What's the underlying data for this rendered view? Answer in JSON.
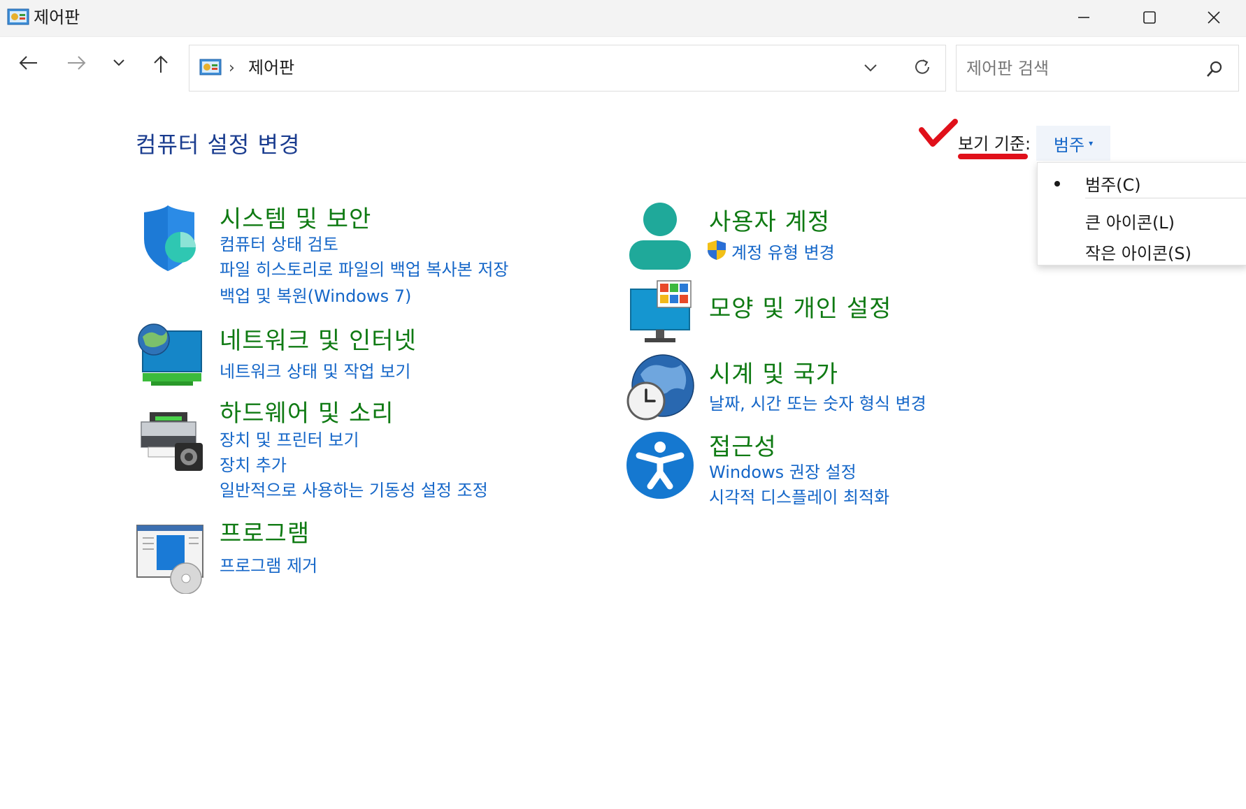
{
  "window": {
    "title": "제어판"
  },
  "address": {
    "breadcrumb": "제어판"
  },
  "search": {
    "placeholder": "제어판 검색"
  },
  "header": {
    "title": "컴퓨터 설정 변경",
    "view_by_label": "보기 기준:",
    "view_by_value": "범주"
  },
  "view_menu": {
    "items": [
      {
        "label": "범주(C)",
        "selected": true
      },
      {
        "label": "큰 아이콘(L)",
        "selected": false
      },
      {
        "label": "작은 아이콘(S)",
        "selected": false
      }
    ]
  },
  "categories": {
    "system_security": {
      "title": "시스템 및 보안",
      "links": [
        "컴퓨터 상태 검토",
        "파일 히스토리로 파일의 백업 복사본 저장",
        "백업 및 복원(Windows 7)"
      ]
    },
    "network": {
      "title": "네트워크 및 인터넷",
      "links": [
        "네트워크 상태 및 작업 보기"
      ]
    },
    "hardware": {
      "title": "하드웨어 및 소리",
      "links": [
        "장치 및 프린터 보기",
        "장치 추가",
        "일반적으로 사용하는 기동성 설정 조정"
      ]
    },
    "programs": {
      "title": "프로그램",
      "links": [
        "프로그램 제거"
      ]
    },
    "user_accounts": {
      "title": "사용자 계정",
      "links": [
        "계정 유형 변경"
      ]
    },
    "appearance": {
      "title": "모양 및 개인 설정",
      "links": []
    },
    "clock_region": {
      "title": "시계 및 국가",
      "links": [
        "날짜, 시간 또는 숫자 형식 변경"
      ]
    },
    "accessibility": {
      "title": "접근성",
      "links": [
        "Windows 권장 설정",
        "시각적 디스플레이 최적화"
      ]
    }
  },
  "colors": {
    "category_title": "#0f7a13",
    "link": "#1466c8",
    "page_title": "#1a3c8f",
    "annotation": "#e0101a"
  }
}
